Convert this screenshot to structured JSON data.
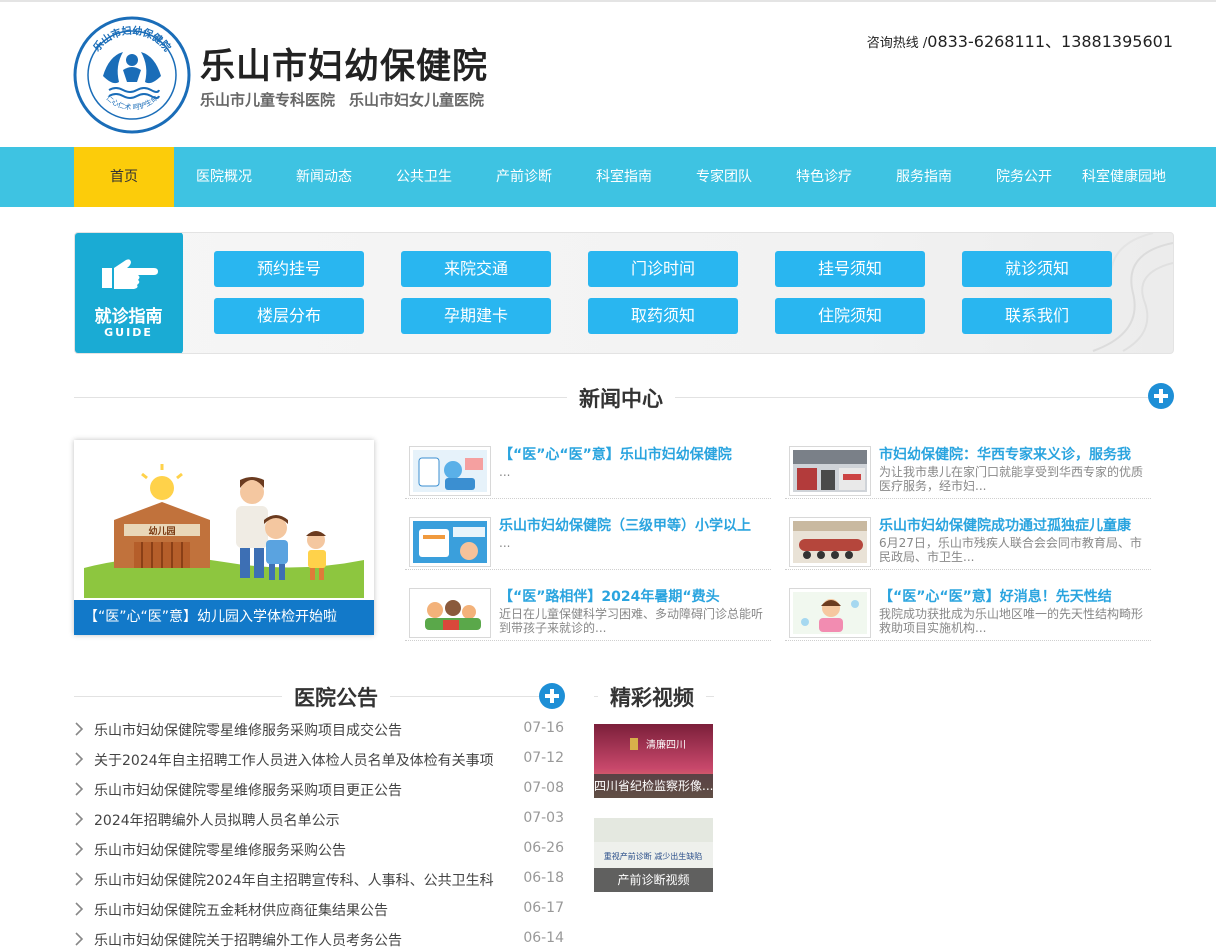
{
  "header": {
    "title": "乐山市妇幼保健院",
    "subtitles": [
      "乐山市儿童专科医院",
      "乐山市妇女儿童医院"
    ],
    "hotline_label": "咨询热线 /",
    "hotline_numbers": "0833-6268111、13881395601",
    "logo_text_top": "乐山市妇幼保健院",
    "logo_text_bottom": "仁心仁术 呵护生命"
  },
  "nav": [
    "首页",
    "医院概况",
    "新闻动态",
    "公共卫生",
    "产前诊断",
    "科室指南",
    "专家团队",
    "特色诊疗",
    "服务指南",
    "院务公开",
    "科室健康园地"
  ],
  "guide": {
    "title": "就诊指南",
    "subtitle": "GUIDE",
    "buttons": [
      "预约挂号",
      "来院交通",
      "门诊时间",
      "挂号须知",
      "就诊须知",
      "楼层分布",
      "孕期建卡",
      "取药须知",
      "住院须知",
      "联系我们"
    ]
  },
  "news_center": {
    "title": "新闻中心",
    "featured_caption": "【“医”心“医”意】幼儿园入学体检开始啦",
    "featured_image_text": "幼儿园",
    "items": [
      {
        "title": "【“医”心“医”意】乐山市妇幼保健院",
        "desc": "..."
      },
      {
        "title": "市妇幼保健院：华西专家来义诊，服务我",
        "desc": "为让我市患儿在家门口就能享受到华西专家的优质医疗服务，经市妇..."
      },
      {
        "title": "乐山市妇幼保健院（三级甲等）小学以上",
        "desc": "..."
      },
      {
        "title": "乐山市妇幼保健院成功通过孤独症儿童康",
        "desc": "6月27日，乐山市残疾人联合会会同市教育局、市民政局、市卫生..."
      },
      {
        "title": "【“医”路相伴】2024年暑期“费头",
        "desc": "近日在儿童保健科学习困难、多动障碍门诊总能听到带孩子来就诊的..."
      },
      {
        "title": "【“医”心“医”意】好消息！先天性结",
        "desc": "我院成功获批成为乐山地区唯一的先天性结构畸形救助项目实施机构..."
      }
    ]
  },
  "notices": {
    "title": "医院公告",
    "items": [
      {
        "title": "乐山市妇幼保健院零星维修服务采购项目成交公告",
        "date": "07-16"
      },
      {
        "title": "关于2024年自主招聘工作人员进入体检人员名单及体检有关事项",
        "date": "07-12"
      },
      {
        "title": "乐山市妇幼保健院零星维修服务采购项目更正公告",
        "date": "07-08"
      },
      {
        "title": "2024年招聘编外人员拟聘人员名单公示",
        "date": "07-03"
      },
      {
        "title": "乐山市妇幼保健院零星维修服务采购公告",
        "date": "06-26"
      },
      {
        "title": "乐山市妇幼保健院2024年自主招聘宣传科、人事科、公共卫生科",
        "date": "06-18"
      },
      {
        "title": "乐山市妇幼保健院五金耗材供应商征集结果公告",
        "date": "06-17"
      },
      {
        "title": "乐山市妇幼保健院关于招聘编外工作人员考务公告",
        "date": "06-14"
      }
    ]
  },
  "videos": {
    "title": "精彩视频",
    "items": [
      {
        "caption": "四川省纪检监察形像...",
        "image_text": "清廉四川"
      },
      {
        "caption": "产前诊断视频",
        "image_text": "重视产前诊断 减少出生缺陷"
      }
    ]
  },
  "colors": {
    "nav_bg": "#3ec3e2",
    "nav_active": "#fccc0a",
    "guide_badge": "#1aabd4",
    "guide_button": "#29b6f0",
    "news_title": "#2aa4df",
    "featured_caption_bg": "#1279c9",
    "plus_icon": "#1e8fd6"
  }
}
